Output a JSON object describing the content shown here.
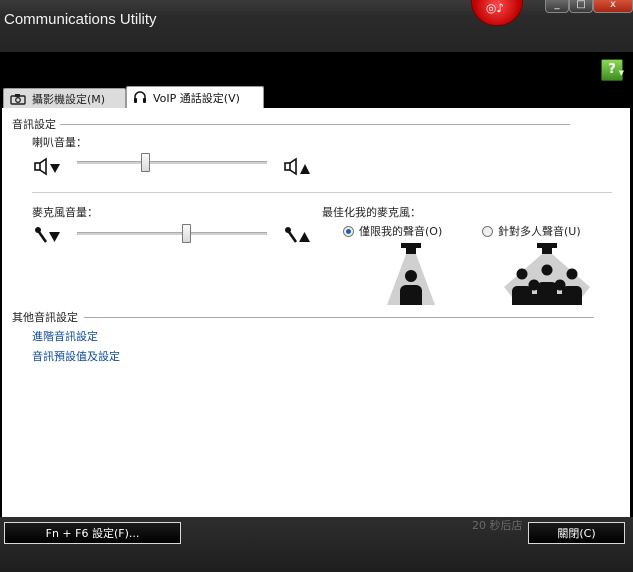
{
  "window": {
    "title": "Communications Utility",
    "controls": {
      "minimize": "_",
      "maximize": "□",
      "close": "x"
    }
  },
  "help": {
    "label": "?"
  },
  "tabs": [
    {
      "label": "攝影機設定(M)",
      "icon": "camera-icon",
      "active": false
    },
    {
      "label": "VoIP 通話設定(V)",
      "icon": "headset-icon",
      "active": true
    }
  ],
  "audio": {
    "section_title": "音訊設定",
    "speaker_label": "喇叭音量：",
    "speaker_level": 0.4,
    "mic_label": "麥克風音量：",
    "mic_level": 0.58,
    "optimize_label": "最佳化我的麥克風：",
    "options": [
      {
        "label": "僅限我的聲音(O)",
        "selected": true,
        "icon": "single-person-icon"
      },
      {
        "label": "針對多人聲音(U)",
        "selected": false,
        "icon": "group-people-icon"
      }
    ]
  },
  "other": {
    "section_title": "其他音訊設定",
    "links": [
      "進階音訊設定",
      "音訊預設值及設定"
    ]
  },
  "footer": {
    "fn_button": "Fn + F6 設定(F)...",
    "close_button": "關閉(C)",
    "ghost_text": "20 秒后店"
  },
  "colors": {
    "accent": "#1b5fb6",
    "link": "#0b4a9e",
    "help": "#4fa82a",
    "badge": "#d40000"
  }
}
